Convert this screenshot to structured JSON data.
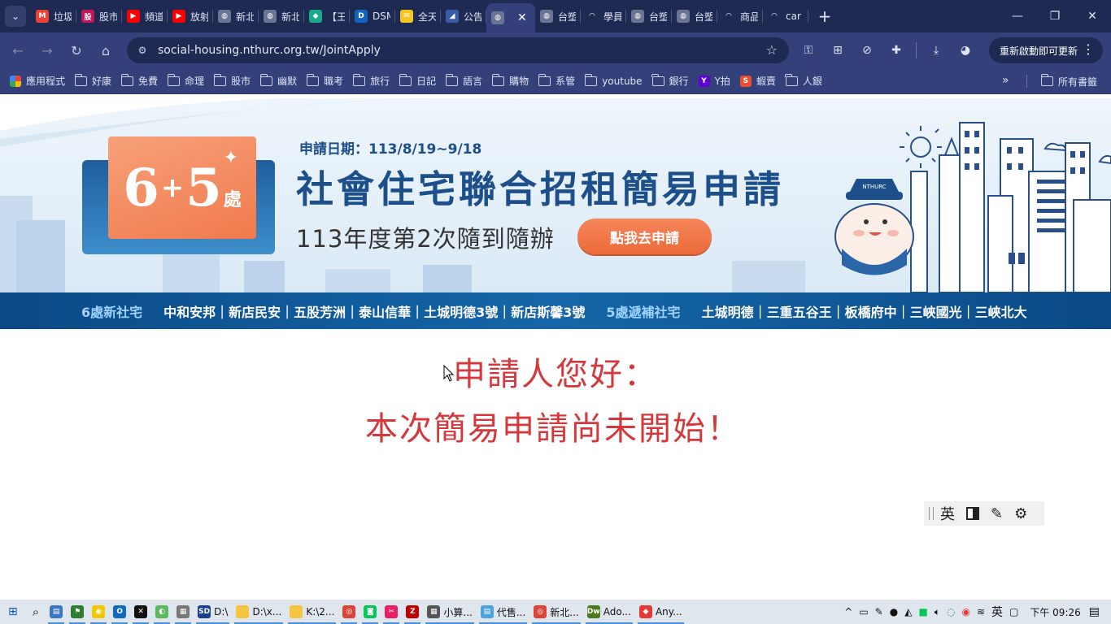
{
  "tabs": [
    {
      "title": "垃圾",
      "icon": "gmail-icon",
      "color": "#ea4335",
      "glyph": "M"
    },
    {
      "title": "股市",
      "icon": "stock-app-icon",
      "color": "#c2185b",
      "glyph": "股"
    },
    {
      "title": "頻道",
      "icon": "youtube-icon",
      "color": "#ff0000",
      "glyph": "▶"
    },
    {
      "title": "放射",
      "icon": "youtube-icon",
      "color": "#ff0000",
      "glyph": "▶"
    },
    {
      "title": "新北",
      "icon": "globe-icon",
      "color": "#6c7495",
      "glyph": "◍"
    },
    {
      "title": "新北",
      "icon": "globe-icon",
      "color": "#6c7495",
      "glyph": "◍"
    },
    {
      "title": "【王",
      "icon": "green-logo-icon",
      "color": "#19a98b",
      "glyph": "◆"
    },
    {
      "title": "DSM",
      "icon": "dsm-icon",
      "color": "#1565c0",
      "glyph": "D"
    },
    {
      "title": "全天",
      "icon": "mail-icon",
      "color": "#f3c623",
      "glyph": "✉"
    },
    {
      "title": "公告",
      "icon": "chart-icon",
      "color": "#3a5aa8",
      "glyph": "◢"
    }
  ],
  "tabs_after": [
    {
      "title": "台塑",
      "icon": "globe-icon",
      "color": "#6c7495",
      "glyph": "◍"
    },
    {
      "title": "學員",
      "icon": "loading-icon",
      "color": "#1f2a52",
      "glyph": "◠"
    },
    {
      "title": "台塑",
      "icon": "globe-icon",
      "color": "#6c7495",
      "glyph": "◍"
    },
    {
      "title": "台塑",
      "icon": "globe-icon",
      "color": "#6c7495",
      "glyph": "◍"
    },
    {
      "title": "商品",
      "icon": "loading-icon",
      "color": "#1f2a52",
      "glyph": "◠"
    },
    {
      "title": "car",
      "icon": "loading-icon",
      "color": "#1f2a52",
      "glyph": "◠"
    }
  ],
  "address_bar": {
    "url": "social-housing.nthurc.org.tw/JointApply"
  },
  "update_button": {
    "label": "重新啟動即可更新"
  },
  "bookmarks": [
    {
      "label": "應用程式",
      "kind": "apps"
    },
    {
      "label": "好康",
      "kind": "folder"
    },
    {
      "label": "免費",
      "kind": "folder"
    },
    {
      "label": "命理",
      "kind": "folder"
    },
    {
      "label": "股市",
      "kind": "folder"
    },
    {
      "label": "幽默",
      "kind": "folder"
    },
    {
      "label": "職考",
      "kind": "folder"
    },
    {
      "label": "旅行",
      "kind": "folder"
    },
    {
      "label": "日記",
      "kind": "folder"
    },
    {
      "label": "語言",
      "kind": "folder"
    },
    {
      "label": "購物",
      "kind": "folder"
    },
    {
      "label": "系管",
      "kind": "folder"
    },
    {
      "label": "youtube",
      "kind": "folder"
    },
    {
      "label": "銀行",
      "kind": "folder"
    },
    {
      "label": "Y拍",
      "kind": "yahoo"
    },
    {
      "label": "蝦賣",
      "kind": "shopee"
    },
    {
      "label": "人銀",
      "kind": "folder"
    }
  ],
  "bookmarks_all": "所有書籤",
  "banner": {
    "badge_number_a": "6",
    "badge_plus": "+",
    "badge_number_b": "5",
    "badge_unit": "處",
    "apply_date": "申請日期：113/8/19~9/18",
    "title": "社會住宅聯合招租簡易申請",
    "subtitle": "113年度第2次隨到隨辦",
    "cta": "點我去申請",
    "mascot_hat": "NTHURC"
  },
  "strip": {
    "new_label": "6處新社宅",
    "new_list": "中和安邦｜新店民安｜五股芳洲｜泰山信華｜土城明德3號｜新店斯馨3號",
    "fill_label": "5處遞補社宅",
    "fill_list": "土城明德｜三重五谷王｜板橋府中｜三峽國光｜三峽北大"
  },
  "message": {
    "line1": "申請人您好：",
    "line2": "本次簡易申請尚未開始！"
  },
  "ime": {
    "mode": "英"
  },
  "taskbar": {
    "items": [
      {
        "label": "",
        "icon": "file-explorer-icon",
        "color": "#3b78c4",
        "glyph": "▤"
      },
      {
        "label": "",
        "icon": "network-icon",
        "color": "#2e7d32",
        "glyph": "⚑"
      },
      {
        "label": "",
        "icon": "sticky-icon",
        "color": "#f2c600",
        "glyph": "◉"
      },
      {
        "label": "",
        "icon": "outlook-icon",
        "color": "#0f6cbd",
        "glyph": "O"
      },
      {
        "label": "",
        "icon": "capcut-icon",
        "color": "#111111",
        "glyph": "✕"
      },
      {
        "label": "",
        "icon": "green-app-icon",
        "color": "#5cb85c",
        "glyph": "◐"
      },
      {
        "label": "",
        "icon": "printer-icon",
        "color": "#777777",
        "glyph": "▦"
      },
      {
        "label": "D:\\",
        "icon": "sd-icon",
        "color": "#1a3f8f",
        "glyph": "SD"
      },
      {
        "label": "D:\\x...",
        "icon": "folder-icon",
        "color": "#f5c542",
        "glyph": " "
      },
      {
        "label": "K:\\2...",
        "icon": "folder-icon",
        "color": "#f5c542",
        "glyph": " "
      },
      {
        "label": "",
        "icon": "chrome-icon",
        "color": "#db4437",
        "glyph": "◎"
      },
      {
        "label": "",
        "icon": "line-icon",
        "color": "#06c755",
        "glyph": "◙"
      },
      {
        "label": "",
        "icon": "snip-icon",
        "color": "#e91e63",
        "glyph": "✂"
      },
      {
        "label": "",
        "icon": "filezilla-icon",
        "color": "#bf0000",
        "glyph": "Z"
      },
      {
        "label": "小算...",
        "icon": "calculator-icon",
        "color": "#555555",
        "glyph": "▦"
      },
      {
        "label": "代售...",
        "icon": "notepad-icon",
        "color": "#4aa3df",
        "glyph": "▤"
      },
      {
        "label": "新北...",
        "icon": "chrome-icon",
        "color": "#db4437",
        "glyph": "◎"
      },
      {
        "label": "Ado...",
        "icon": "dreamweaver-icon",
        "color": "#4a7a1e",
        "glyph": "Dw"
      },
      {
        "label": "Any...",
        "icon": "anydesk-icon",
        "color": "#e53935",
        "glyph": "◆"
      }
    ],
    "tray_ime": "英",
    "clock": "下午 09:26"
  }
}
